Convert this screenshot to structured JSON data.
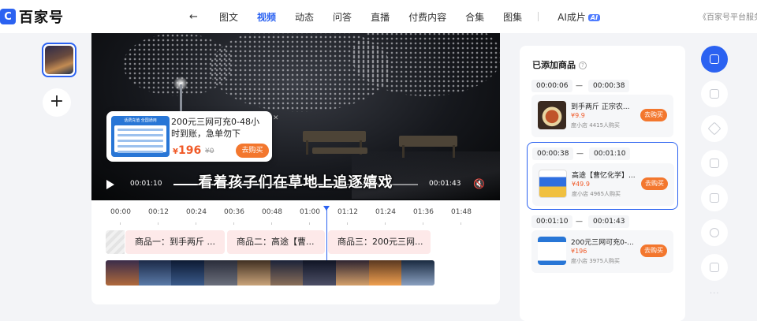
{
  "header": {
    "logo_text": "百家号",
    "back_icon": "arrow-left-icon",
    "tabs": [
      {
        "label": "图文",
        "active": false
      },
      {
        "label": "视频",
        "active": true
      },
      {
        "label": "动态",
        "active": false
      },
      {
        "label": "问答",
        "active": false
      },
      {
        "label": "直播",
        "active": false
      },
      {
        "label": "付费内容",
        "active": false
      },
      {
        "label": "合集",
        "active": false
      },
      {
        "label": "图集",
        "active": false
      }
    ],
    "ai_tab": {
      "label": "AI成片",
      "badge": "AI"
    },
    "right_text": "《百家号平台服务"
  },
  "player": {
    "subtitle": "看着孩子们在草地上追逐嬉戏",
    "current_time": "00:01:10",
    "total_time": "00:01:43",
    "progress": 0.68,
    "popup": {
      "title": "200元三网可充0-48小时到账，急单勿下",
      "price_symbol": "¥",
      "price": "196",
      "old_price": "¥0",
      "buy_label": "去购买",
      "close_icon": "close-icon",
      "image_caption": "话费充值 全国通用"
    }
  },
  "timeline": {
    "ticks": [
      "00:00",
      "00:12",
      "00:24",
      "00:36",
      "00:48",
      "01:00",
      "01:12",
      "01:24",
      "01:36",
      "01:48"
    ],
    "segments": [
      "商品一：到手两斤 ...",
      "商品二：高途【曹...",
      "商品三：200元三网..."
    ]
  },
  "products_panel": {
    "title": "已添加商品",
    "groups": [
      {
        "start": "00:00:06",
        "end": "00:00:38",
        "title": "到手两斤 正宗农...",
        "price": "¥9.9",
        "shop": "度小店",
        "buyers": "4415人购买",
        "buy_label": "去购买",
        "active": false
      },
      {
        "start": "00:00:38",
        "end": "00:01:10",
        "title": "高途【曹忆化学】...",
        "price": "¥49.9",
        "shop": "度小店",
        "buyers": "4965人购买",
        "buy_label": "去购买",
        "active": true
      },
      {
        "start": "00:01:10",
        "end": "00:01:43",
        "title": "200元三网可充0-...",
        "price": "¥196",
        "shop": "度小店",
        "buyers": "3975人购买",
        "buy_label": "去购买",
        "active": false
      }
    ],
    "range_separator": "—"
  },
  "colors": {
    "accent": "#2b62f1",
    "buy": "#f3772e",
    "price": "#f05a28"
  }
}
